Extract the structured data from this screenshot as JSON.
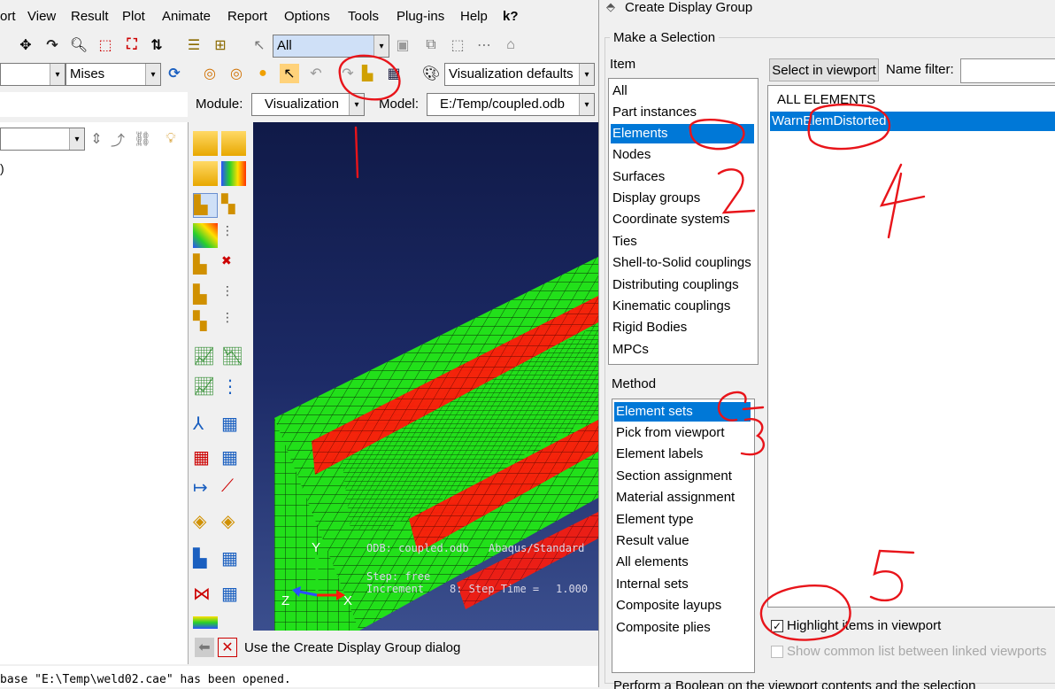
{
  "menu": {
    "items": [
      "ort",
      "View",
      "Result",
      "Plot",
      "Animate",
      "Report",
      "Options",
      "Tools",
      "Plug-ins",
      "Help"
    ],
    "help_arrow": "k?"
  },
  "toolbar": {
    "selection_combo": "All",
    "field_combo": "Mises",
    "visualization_defaults": "Visualization defaults",
    "module_label": "Module:",
    "module_value": "Visualization",
    "model_label": "Model:",
    "model_value": "E:/Temp/coupled.odb"
  },
  "tree": {
    "partial_text": ")"
  },
  "viewport": {
    "odb_text": "ODB: coupled.odb",
    "solver_text": "Abaqus/Standard",
    "step_text": "Step: free",
    "increment_text": "Increment",
    "increment_value": "8: Step Time =",
    "step_time": "1.000",
    "axis_y": "Y",
    "axis_z": "Z",
    "axis_x": "X"
  },
  "prompt": {
    "text": "Use the Create Display Group dialog"
  },
  "message": {
    "text": "base \"E:\\Temp\\weld02.cae\" has been opened."
  },
  "dialog": {
    "title": "Create Display Group",
    "make_selection": "Make a Selection",
    "item_label": "Item",
    "items": [
      "All",
      "Part instances",
      "Elements",
      "Nodes",
      "Surfaces",
      "Display groups",
      "Coordinate systems",
      "Ties",
      "Shell-to-Solid couplings",
      "Distributing couplings",
      "Kinematic couplings",
      "Rigid Bodies",
      "MPCs"
    ],
    "selected_item": "Elements",
    "method_label": "Method",
    "methods": [
      "Element sets",
      "Pick from viewport",
      "Element labels",
      "Section assignment",
      "Material assignment",
      "Element type",
      "Result value",
      "All elements",
      "Internal sets",
      "Composite layups",
      "Composite plies"
    ],
    "selected_method": "Element sets",
    "select_in_viewport": "Select in viewport",
    "name_filter_label": "Name filter:",
    "name_filter_value": "",
    "sets": [
      "ALL ELEMENTS",
      "WarnElemDistorted"
    ],
    "selected_set": "WarnElemDistorted",
    "highlight_label": "Highlight items in viewport",
    "highlight_checked": true,
    "show_common_label": "Show common list between linked viewports",
    "show_common_checked": false,
    "boolean_text": "Perform a Boolean on the viewport contents and the selection"
  },
  "annotations": {
    "numbers": [
      "1",
      "2",
      "3",
      "4",
      "5"
    ],
    "color": "#e8141a"
  },
  "colors": {
    "mesh_green": "#22e01a",
    "mesh_red": "#ff1a0a",
    "selection_blue": "#0078d7",
    "viewport_top": "#101a48"
  }
}
